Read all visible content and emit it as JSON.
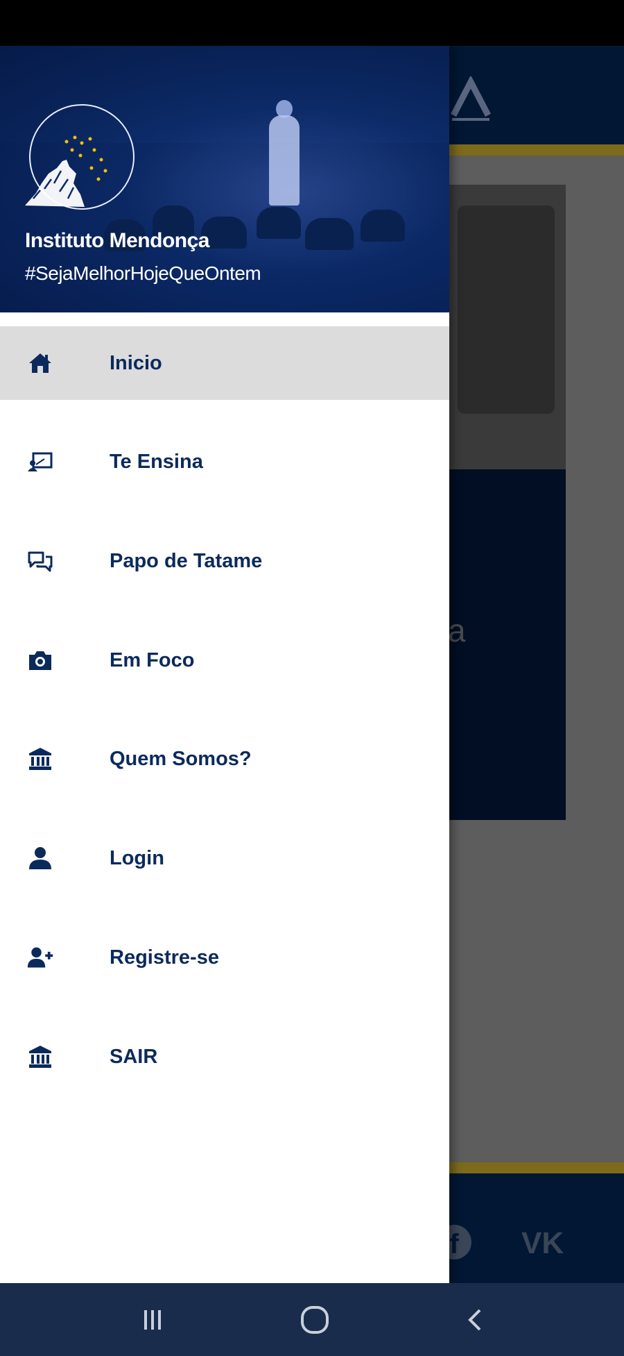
{
  "drawer": {
    "title": "Instituto Mendonça",
    "tagline": "#SejaMelhorHojeQueOntem",
    "items": [
      {
        "label": "Inicio",
        "icon": "home-icon",
        "active": true
      },
      {
        "label": "Te Ensina",
        "icon": "presentation-icon",
        "active": false
      },
      {
        "label": "Papo de Tatame",
        "icon": "chat-icon",
        "active": false
      },
      {
        "label": "Em Foco",
        "icon": "camera-icon",
        "active": false
      },
      {
        "label": "Quem Somos?",
        "icon": "institution-icon",
        "active": false
      },
      {
        "label": "Login",
        "icon": "user-icon",
        "active": false
      },
      {
        "label": "Registre-se",
        "icon": "user-plus-icon",
        "active": false
      },
      {
        "label": "SAIR",
        "icon": "institution-icon",
        "active": false
      }
    ]
  },
  "background": {
    "card_text": "a",
    "footer_icons": [
      "facebook-icon",
      "vk-icon"
    ]
  },
  "navbar": {
    "buttons": [
      "recent-apps-icon",
      "home-circle-icon",
      "back-icon"
    ]
  },
  "colors": {
    "navy": "#021734",
    "drawer_text": "#0b2a5c",
    "gold": "#7d6a1a",
    "active_item": "#dcdcdc"
  }
}
